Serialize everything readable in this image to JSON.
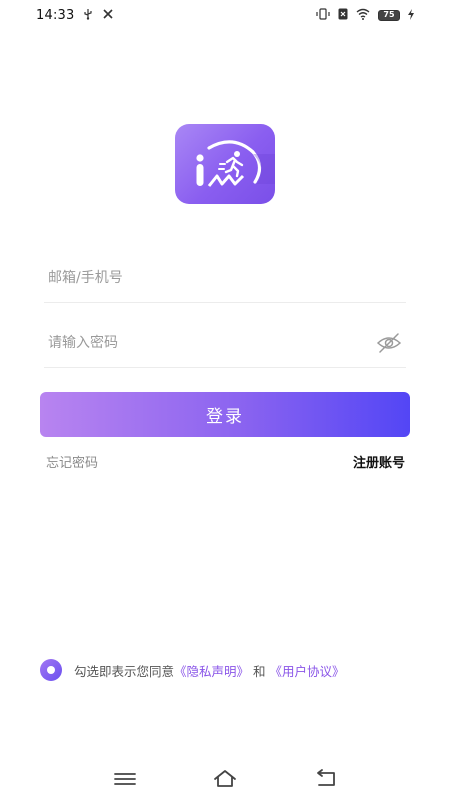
{
  "status_bar": {
    "time": "14:33",
    "battery": "75"
  },
  "login_form": {
    "email_placeholder": "邮箱/手机号",
    "password_placeholder": "请输入密码",
    "login_label": "登录",
    "forgot_label": "忘记密码",
    "register_label": "注册账号"
  },
  "agreement": {
    "prefix": "勾选即表示您同意",
    "privacy_link": "《隐私声明》",
    "and": "和",
    "terms_link": "《用户协议》",
    "checked": true
  },
  "colors": {
    "accent": "#8a5ef0",
    "button_start": "#b884f0",
    "button_end": "#5346f5",
    "link": "#8a55e8"
  },
  "icons": {
    "logo": "runner-app-logo",
    "password_toggle": "eye-off-icon",
    "nav": [
      "menu-icon",
      "home-icon",
      "back-icon"
    ]
  }
}
